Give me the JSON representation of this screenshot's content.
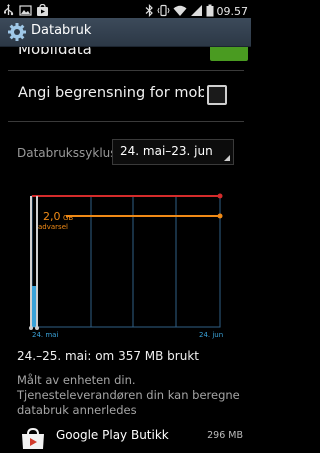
{
  "status_bar": {
    "time": "09.57",
    "left_icons": [
      "usb-icon",
      "image-icon",
      "play-store-icon"
    ],
    "right_icons": [
      "bluetooth-icon",
      "vibrate-icon",
      "wifi-icon",
      "signal-icon",
      "battery-icon"
    ]
  },
  "action_bar": {
    "title": "Databruk",
    "icon": "gear-icon"
  },
  "settings": {
    "mobile_data_label": "Mobildata",
    "mobile_data_on": true,
    "limit_label": "Angi begrensning for mobildata",
    "limit_checked": false
  },
  "cycle": {
    "label": "Databrukssyklus",
    "value": "24. mai–23. jun"
  },
  "chart": {
    "warning_value": "2,0",
    "warning_unit": "GB",
    "warning_label": "advarsel",
    "start_label": "24. mai",
    "end_label": "24. jun",
    "colors": {
      "limit": "#d42b2b",
      "warning": "#f08a16",
      "usage": "#3aa2d8",
      "grid": "#2f5f86"
    }
  },
  "chart_data": {
    "type": "area",
    "x": [
      "24. mai",
      "25. mai"
    ],
    "values": [
      0,
      357
    ],
    "unit": "MB",
    "warning_level": "2,0 GB",
    "x_range": [
      "24. mai",
      "24. jun"
    ]
  },
  "summary": "24.–25. mai: om 357 MB brukt",
  "note": "Målt av enheten din. Tjenesteleverandøren din kan beregne databruk annerledes",
  "apps": [
    {
      "name": "Google Play Butikk",
      "size": "296 MB",
      "icon": "play-store-bag-icon"
    }
  ]
}
